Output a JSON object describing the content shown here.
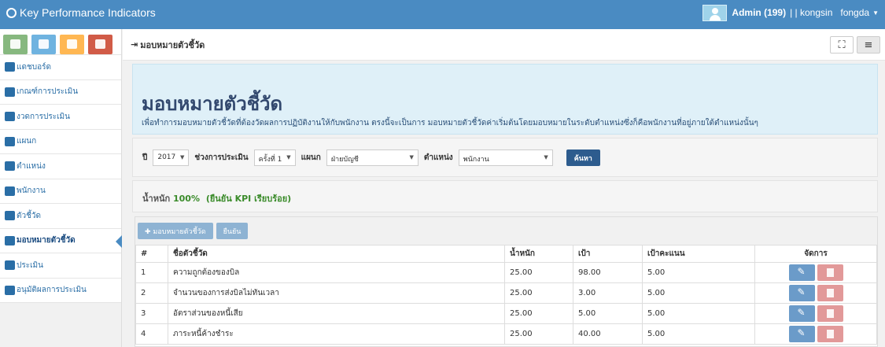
{
  "app": {
    "title": "Key Performance Indicators"
  },
  "user": {
    "name": "Admin (199)",
    "sep": " | | kongsin",
    "extra": "fongda"
  },
  "sidebar": {
    "items": [
      {
        "label": "แดชบอร์ด"
      },
      {
        "label": "เกณฑ์การประเมิน"
      },
      {
        "label": "งวดการประเมิน"
      },
      {
        "label": "แผนก"
      },
      {
        "label": "ตำแหน่ง"
      },
      {
        "label": "พนักงาน"
      },
      {
        "label": "ตัวชี้วัด"
      },
      {
        "label": "มอบหมายตัวชี้วัด"
      },
      {
        "label": "ประเมิน"
      },
      {
        "label": "อนุมัติผลการประเมิน"
      }
    ]
  },
  "page": {
    "breadcrumb": "มอบหมายตัวชี้วัด",
    "hero_title": "มอบหมายตัวชี้วัด",
    "hero_desc": "เพื่อทำการมอบหมายตัวชี้วัดที่ต้องวัดผลการปฏิบัติงานให้กับพนักงาน ตรงนี้จะเป็นการ มอบหมายตัวชี้วัดค่าเริ่มต้นโดยมอบหมายในระดับตำแหน่งซึ่งก็คือพนักงานที่อยู่ภายใต้ตำแหน่งนั้นๆ"
  },
  "filter": {
    "year_label": "ปี",
    "year": "2017",
    "period_label": "ช่วงการประเมิน",
    "period": "ครั้งที่ 1",
    "dept_label": "แผนก",
    "dept": "ฝ่ายบัญชี",
    "pos_label": "ตำแหน่ง",
    "pos": "พนักงาน",
    "search": "ค้นหา"
  },
  "weight": {
    "label": "น้ำหนัก",
    "value": "100%",
    "note": "(ยืนยัน KPI เรียบร้อย)"
  },
  "toolbar": {
    "assign": "มอบหมายตัวชี้วัด",
    "confirm": "ยืนยัน"
  },
  "table": {
    "headers": [
      "#",
      "ชื่อตัวชี้วัด",
      "น้ำหนัก",
      "เป้า",
      "เป้าคะแนน",
      "จัดการ"
    ],
    "rows": [
      [
        "1",
        "ความถูกต้องของบิล",
        "25.00",
        "98.00",
        "5.00"
      ],
      [
        "2",
        "จำนวนของการส่งบิลไม่ทันเวลา",
        "25.00",
        "3.00",
        "5.00"
      ],
      [
        "3",
        "อัตราส่วนของหนี้เสีย",
        "25.00",
        "5.00",
        "5.00"
      ],
      [
        "4",
        "ภาระหนี้ค้างชำระ",
        "25.00",
        "40.00",
        "5.00"
      ]
    ]
  }
}
